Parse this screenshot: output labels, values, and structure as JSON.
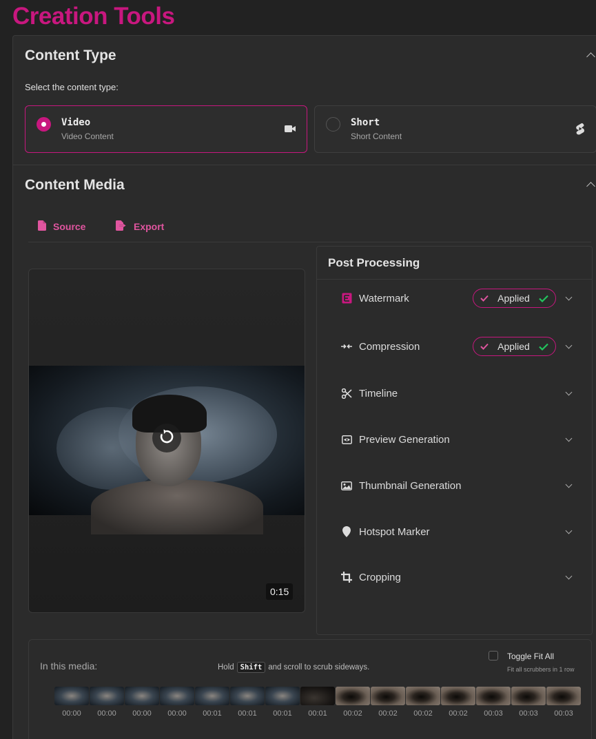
{
  "app": {
    "title": "Creation Tools"
  },
  "content_type": {
    "title": "Content Type",
    "instruction": "Select the content type:",
    "options": [
      {
        "title": "Video",
        "subtitle": "Video Content",
        "selected": true,
        "icon": "video-camera-icon"
      },
      {
        "title": "Short",
        "subtitle": "Short Content",
        "selected": false,
        "icon": "shorts-icon"
      }
    ]
  },
  "content_media": {
    "title": "Content Media",
    "tabs": [
      {
        "label": "Source",
        "icon": "file-icon"
      },
      {
        "label": "Export",
        "icon": "file-export-icon"
      }
    ],
    "player": {
      "time": "0:15",
      "overlay_icon": "replay-icon"
    }
  },
  "post_processing": {
    "title": "Post Processing",
    "items": [
      {
        "label": "Watermark",
        "icon": "watermark-icon",
        "status": "Applied"
      },
      {
        "label": "Compression",
        "icon": "compress-icon",
        "status": "Applied"
      },
      {
        "label": "Timeline",
        "icon": "scissors-icon",
        "status": ""
      },
      {
        "label": "Preview Generation",
        "icon": "preview-icon",
        "status": ""
      },
      {
        "label": "Thumbnail Generation",
        "icon": "image-icon",
        "status": ""
      },
      {
        "label": "Hotspot Marker",
        "icon": "map-pin-icon",
        "status": ""
      },
      {
        "label": "Cropping",
        "icon": "crop-icon",
        "status": ""
      }
    ]
  },
  "media_strip": {
    "label": "In this media:",
    "hint_prefix": "Hold",
    "hint_key": "Shift",
    "hint_suffix": "and scroll to scrub sideways.",
    "toggle_label": "Toggle Fit All",
    "toggle_sub": "Fit all scrubbers in 1 row",
    "toggle_checked": false,
    "thumbs": [
      {
        "time": "00:00",
        "kind": "face"
      },
      {
        "time": "00:00",
        "kind": "face"
      },
      {
        "time": "00:00",
        "kind": "face"
      },
      {
        "time": "00:00",
        "kind": "face"
      },
      {
        "time": "00:01",
        "kind": "face"
      },
      {
        "time": "00:01",
        "kind": "face"
      },
      {
        "time": "00:01",
        "kind": "face"
      },
      {
        "time": "00:01",
        "kind": "dark"
      },
      {
        "time": "00:02",
        "kind": "eye"
      },
      {
        "time": "00:02",
        "kind": "eye"
      },
      {
        "time": "00:02",
        "kind": "eye"
      },
      {
        "time": "00:02",
        "kind": "eye"
      },
      {
        "time": "00:03",
        "kind": "eye"
      },
      {
        "time": "00:03",
        "kind": "eye"
      },
      {
        "time": "00:03",
        "kind": "eye"
      }
    ]
  },
  "colors": {
    "accent": "#c8177f",
    "success": "#22c55e",
    "background": "#222222",
    "panel": "#2b2b2b"
  }
}
